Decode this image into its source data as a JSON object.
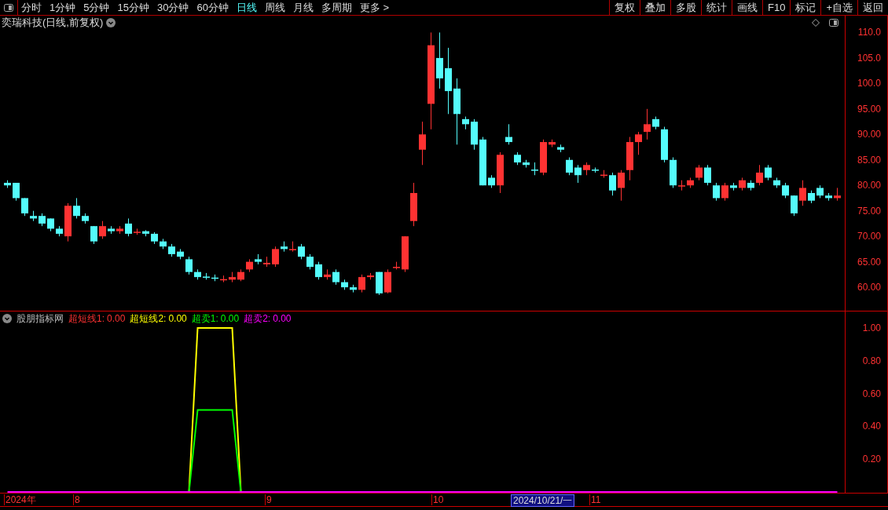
{
  "toolbar": {
    "periods": [
      {
        "label": "分时",
        "selected": false
      },
      {
        "label": "1分钟",
        "selected": false
      },
      {
        "label": "5分钟",
        "selected": false
      },
      {
        "label": "15分钟",
        "selected": false
      },
      {
        "label": "30分钟",
        "selected": false
      },
      {
        "label": "60分钟",
        "selected": false
      },
      {
        "label": "日线",
        "selected": true
      },
      {
        "label": "周线",
        "selected": false
      },
      {
        "label": "月线",
        "selected": false
      },
      {
        "label": "多周期",
        "selected": false
      },
      {
        "label": "更多 >",
        "selected": false
      }
    ],
    "buttons": [
      "复权",
      "叠加",
      "多股",
      "统计",
      "画线",
      "F10",
      "标记",
      "+自选",
      "返回"
    ]
  },
  "price_panel": {
    "title": "奕瑞科技(日线,前复权)",
    "chart_data": {
      "type": "candlestick",
      "ylim": [
        55.4,
        113.3
      ],
      "categories": [
        null,
        null,
        null,
        null,
        null,
        null,
        null,
        null,
        null,
        null,
        null,
        null,
        null,
        null,
        null,
        null,
        null,
        null,
        null,
        null,
        null,
        null,
        null,
        null,
        null,
        null,
        null,
        null,
        null,
        null,
        null,
        null,
        null,
        null,
        null,
        null,
        null,
        null,
        null,
        null,
        null,
        null,
        null,
        null,
        null,
        null,
        null,
        null,
        null,
        null,
        null,
        null,
        null,
        null,
        null,
        null,
        null,
        null,
        null,
        null,
        null,
        null,
        null,
        null,
        null,
        null,
        null,
        null,
        null,
        null,
        null,
        null,
        null,
        null,
        null,
        null,
        null,
        null,
        null,
        null,
        null,
        null,
        null,
        null,
        null,
        null,
        null,
        null,
        null,
        null,
        null,
        null,
        null,
        null,
        null,
        null,
        null
      ],
      "yticks": [
        {
          "value": 110,
          "label": "110.0"
        },
        {
          "value": 105,
          "label": "105.0"
        },
        {
          "value": 100,
          "label": "100.0"
        },
        {
          "value": 95,
          "label": "95.00"
        },
        {
          "value": 90,
          "label": "90.00"
        },
        {
          "value": 85,
          "label": "85.00"
        },
        {
          "value": 80,
          "label": "80.00"
        },
        {
          "value": 75,
          "label": "75.00"
        },
        {
          "value": 70,
          "label": "70.00"
        },
        {
          "value": 65,
          "label": "65.00"
        },
        {
          "value": 60,
          "label": "60.00"
        }
      ],
      "ohlc": [
        [
          80.5,
          81,
          79.5,
          80
        ],
        [
          80.5,
          80.5,
          77,
          77.5
        ],
        [
          77.5,
          77.5,
          74,
          74.5
        ],
        [
          74,
          75,
          73,
          73.5
        ],
        [
          74,
          74.5,
          72,
          72.5
        ],
        [
          73.5,
          73.5,
          71,
          71.5
        ],
        [
          71.5,
          72,
          70,
          70.5
        ],
        [
          70,
          76.5,
          69,
          76
        ],
        [
          76,
          77.5,
          73.5,
          74
        ],
        [
          74,
          74.5,
          72.5,
          73
        ],
        [
          72,
          72,
          68.5,
          69
        ],
        [
          70,
          73,
          69.5,
          72
        ],
        [
          71.5,
          72,
          70.5,
          71
        ],
        [
          71,
          72,
          70.5,
          71.5
        ],
        [
          72.5,
          73.5,
          70,
          70.5
        ],
        [
          70.8,
          71.5,
          70.3,
          70.9
        ],
        [
          71,
          71.2,
          70,
          70.5
        ],
        [
          70.5,
          70.8,
          68.5,
          69
        ],
        [
          69,
          69.5,
          67.5,
          68
        ],
        [
          68,
          68.5,
          66,
          66.5
        ],
        [
          67,
          67.5,
          65.5,
          66
        ],
        [
          65.5,
          66,
          62.5,
          63
        ],
        [
          63,
          63.5,
          61.5,
          62
        ],
        [
          62.1,
          62.8,
          61.5,
          62
        ],
        [
          61.9,
          62.5,
          61.2,
          61.8
        ],
        [
          61.5,
          62.3,
          61,
          61.6
        ],
        [
          61.5,
          63,
          61,
          62
        ],
        [
          61.5,
          63.5,
          61.2,
          63
        ],
        [
          63.5,
          65.5,
          63,
          65
        ],
        [
          65.5,
          66.5,
          64.5,
          65
        ],
        [
          64.5,
          66,
          64,
          64.8
        ],
        [
          64.5,
          68,
          64,
          67.5
        ],
        [
          68,
          69,
          67,
          67.5
        ],
        [
          67.4,
          69,
          67,
          67.5
        ],
        [
          68,
          68.5,
          65.5,
          66
        ],
        [
          66,
          66.5,
          63.5,
          64
        ],
        [
          64.5,
          65,
          61.5,
          62
        ],
        [
          62,
          63.5,
          61.5,
          62.5
        ],
        [
          63,
          63.5,
          60.5,
          61
        ],
        [
          61,
          61.5,
          59.5,
          60
        ],
        [
          60,
          60.5,
          59,
          59.5
        ],
        [
          59.5,
          62.5,
          59,
          62
        ],
        [
          62,
          62.8,
          61.5,
          62.3
        ],
        [
          63,
          63,
          58.5,
          58.8
        ],
        [
          59,
          63.5,
          58.8,
          63
        ],
        [
          63.9,
          65,
          63.5,
          64
        ],
        [
          63.5,
          70,
          63,
          70
        ],
        [
          73,
          80.5,
          72,
          78.5
        ],
        [
          87,
          92.5,
          84,
          90
        ],
        [
          96,
          110,
          91,
          107.5
        ],
        [
          105,
          110,
          99,
          101
        ],
        [
          103,
          107,
          94,
          98.5
        ],
        [
          99,
          101,
          88,
          94
        ],
        [
          93,
          93.5,
          91,
          92
        ],
        [
          92.5,
          93,
          87,
          88
        ],
        [
          89,
          89.5,
          80,
          80
        ],
        [
          81.5,
          82,
          79.5,
          80
        ],
        [
          80,
          86.5,
          78.5,
          86
        ],
        [
          89.5,
          92,
          88,
          88.5
        ],
        [
          86,
          86.5,
          84,
          84.5
        ],
        [
          84.5,
          85,
          83.5,
          84
        ],
        [
          83.1,
          84.5,
          82,
          83
        ],
        [
          82.5,
          89,
          82,
          88.5
        ],
        [
          88,
          89,
          87.5,
          88.5
        ],
        [
          87.5,
          88,
          86.5,
          87
        ],
        [
          85,
          85.5,
          82,
          82.5
        ],
        [
          83.5,
          84,
          80.5,
          82
        ],
        [
          83,
          84.5,
          82,
          84
        ],
        [
          83.1,
          83.5,
          82.5,
          83
        ],
        [
          82,
          83,
          81.5,
          82.1
        ],
        [
          82,
          82.5,
          78,
          79
        ],
        [
          79.5,
          83,
          77,
          82.5
        ],
        [
          83,
          89.5,
          81,
          88.5
        ],
        [
          88.5,
          90.5,
          86,
          90
        ],
        [
          90.5,
          95,
          89,
          92
        ],
        [
          93,
          93.5,
          91,
          91.5
        ],
        [
          91,
          91.5,
          84.5,
          85
        ],
        [
          85,
          85.5,
          79.5,
          80
        ],
        [
          79.9,
          81,
          79,
          80
        ],
        [
          80,
          81.5,
          79.5,
          81
        ],
        [
          81.5,
          84,
          81,
          83.5
        ],
        [
          83.5,
          84,
          80,
          80.5
        ],
        [
          80,
          80.5,
          77,
          77.5
        ],
        [
          77.5,
          80.5,
          77,
          80
        ],
        [
          80,
          80.5,
          79,
          79.5
        ],
        [
          79.5,
          81.5,
          79,
          81
        ],
        [
          80.5,
          81,
          79,
          79.5
        ],
        [
          80.5,
          84,
          80,
          82.5
        ],
        [
          83.5,
          84,
          81,
          81.5
        ],
        [
          81,
          81.5,
          79.5,
          80
        ],
        [
          80,
          80.5,
          77.5,
          78
        ],
        [
          78,
          78,
          74,
          74.5
        ],
        [
          77,
          81,
          76,
          79.5
        ],
        [
          78.5,
          79,
          76.5,
          77
        ],
        [
          79.5,
          80,
          77.5,
          78
        ],
        [
          78,
          78.5,
          77,
          77.5
        ],
        [
          77.5,
          79.5,
          77,
          78
        ]
      ]
    }
  },
  "indicator_panel": {
    "name": "股朋指标网",
    "legend_values": [
      "0.00",
      "0.00",
      "0.00",
      "0.00"
    ],
    "chart_data": {
      "type": "line",
      "ylim": [
        -0.01,
        1.1
      ],
      "yticks": [
        {
          "value": 1,
          "label": "1.00"
        },
        {
          "value": 0.8,
          "label": "0.80"
        },
        {
          "value": 0.6,
          "label": "0.60"
        },
        {
          "value": 0.4,
          "label": "0.40"
        },
        {
          "value": 0.2,
          "label": "0.20"
        }
      ],
      "series": [
        {
          "name": "超短线1:",
          "color": "#ff3232",
          "values": [
            null,
            null,
            null,
            null,
            null,
            null,
            null,
            null,
            null,
            null,
            null,
            null,
            null,
            null,
            null,
            null,
            null,
            null,
            null,
            null,
            null,
            null,
            null,
            null,
            null,
            null,
            null,
            null,
            null,
            null,
            null,
            null,
            null,
            null,
            null,
            null,
            null,
            null,
            null,
            null,
            null,
            null,
            null,
            null,
            null,
            null,
            null,
            null,
            null,
            null,
            null,
            null,
            null,
            null,
            null,
            null,
            null,
            null,
            null,
            null,
            null,
            null,
            null,
            null,
            null,
            null,
            null,
            null,
            null,
            null,
            null,
            null,
            null,
            null,
            null,
            null,
            null,
            null,
            null,
            null,
            null,
            null,
            null,
            null,
            null,
            null,
            null,
            null,
            null,
            null,
            null,
            null,
            null,
            null,
            null,
            null,
            null
          ]
        },
        {
          "name": "超短线2:",
          "color": "#ffff00",
          "values": [
            null,
            null,
            null,
            null,
            null,
            null,
            null,
            null,
            null,
            null,
            null,
            null,
            null,
            null,
            null,
            null,
            null,
            null,
            null,
            null,
            null,
            0,
            1,
            1,
            1,
            1,
            1,
            0,
            null,
            null,
            null,
            null,
            null,
            null,
            null,
            null,
            null,
            null,
            null,
            null,
            null,
            null,
            null,
            null,
            null,
            null,
            null,
            null,
            null,
            null,
            null,
            null,
            null,
            null,
            null,
            null,
            null,
            null,
            null,
            null,
            null,
            null,
            null,
            null,
            null,
            null,
            null,
            null,
            null,
            null,
            null,
            null,
            null,
            null,
            null,
            null,
            null,
            null,
            null,
            null,
            null,
            null,
            null,
            null,
            null,
            null,
            null,
            null,
            null,
            null,
            null,
            null,
            null,
            null,
            null,
            null,
            null
          ]
        },
        {
          "name": "超卖1:",
          "color": "#00ff00",
          "values": [
            null,
            null,
            null,
            null,
            null,
            null,
            null,
            null,
            null,
            null,
            null,
            null,
            null,
            null,
            null,
            null,
            null,
            null,
            null,
            null,
            null,
            0,
            0.5,
            0.5,
            0.5,
            0.5,
            0.5,
            0,
            null,
            null,
            null,
            null,
            null,
            null,
            null,
            null,
            null,
            null,
            null,
            null,
            null,
            null,
            null,
            null,
            null,
            null,
            null,
            null,
            null,
            null,
            null,
            null,
            null,
            null,
            null,
            null,
            null,
            null,
            null,
            null,
            null,
            null,
            null,
            null,
            null,
            null,
            null,
            null,
            null,
            null,
            null,
            null,
            null,
            null,
            null,
            null,
            null,
            null,
            null,
            null,
            null,
            null,
            null,
            null,
            null,
            null,
            null,
            null,
            null,
            null,
            null,
            null,
            null,
            null,
            null,
            null,
            null
          ]
        },
        {
          "name": "超卖2:",
          "color": "#ff00ff",
          "values": [
            0,
            0,
            0,
            0,
            0,
            0,
            0,
            0,
            0,
            0,
            0,
            0,
            0,
            0,
            0,
            0,
            0,
            0,
            0,
            0,
            0,
            0,
            0,
            0,
            0,
            0,
            0,
            0,
            0,
            0,
            0,
            0,
            0,
            0,
            0,
            0,
            0,
            0,
            0,
            0,
            0,
            0,
            0,
            0,
            0,
            0,
            0,
            0,
            0,
            0,
            0,
            0,
            0,
            0,
            0,
            0,
            0,
            0,
            0,
            0,
            0,
            0,
            0,
            0,
            0,
            0,
            0,
            0,
            0,
            0,
            0,
            0,
            0,
            0,
            0,
            0,
            0,
            0,
            0,
            0,
            0,
            0,
            0,
            0,
            0,
            0,
            0,
            0,
            0,
            0,
            0,
            0,
            0,
            0,
            0,
            0,
            0
          ]
        }
      ]
    }
  },
  "timeline": [
    {
      "label": "2024年",
      "selected": false
    },
    {
      "label": "8",
      "selected": false
    },
    {
      "label": "9",
      "selected": false
    },
    {
      "label": "10",
      "selected": false
    },
    {
      "label": "2024/10/21/一",
      "selected": true
    },
    {
      "label": "11",
      "selected": false
    }
  ]
}
